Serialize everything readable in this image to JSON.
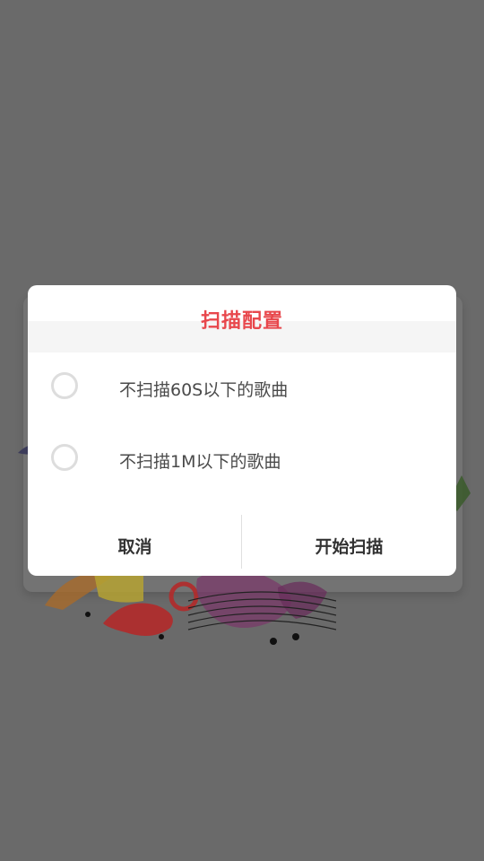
{
  "dialog": {
    "title": "扫描配置",
    "options": [
      {
        "label": "不扫描60S以下的歌曲",
        "checked": false
      },
      {
        "label": "不扫描1M以下的歌曲",
        "checked": false
      }
    ],
    "cancel_label": "取消",
    "start_label": "开始扫描"
  },
  "colors": {
    "title": "#e8474c",
    "overlay": "#6a6a6a",
    "radio_border": "#dddddd"
  },
  "background_art": {
    "icon": "music-notes-illustration"
  }
}
